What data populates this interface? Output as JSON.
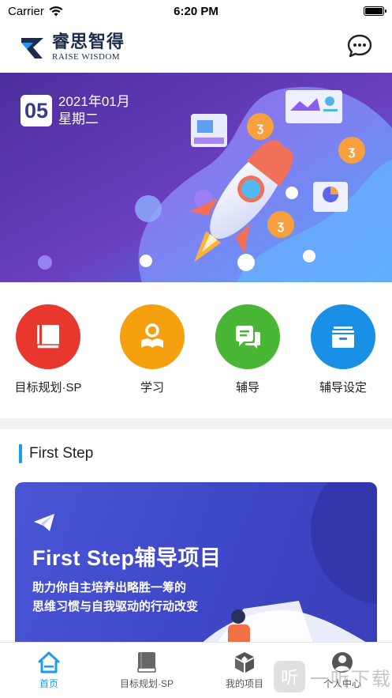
{
  "status_bar": {
    "carrier": "Carrier",
    "time": "6:20 PM",
    "battery_level": 1.0
  },
  "header": {
    "logo_cn": "睿思智得",
    "logo_en": "RAISE WISDOM",
    "chat_icon": "chat-bubble-icon"
  },
  "banner": {
    "day": "05",
    "month": "2021年01月",
    "weekday": "星期二"
  },
  "quick_actions": [
    {
      "label": "目标规划·SP",
      "icon": "book-icon",
      "color": "#e8372c"
    },
    {
      "label": "学习",
      "icon": "reader-icon",
      "color": "#f5a00e"
    },
    {
      "label": "辅导",
      "icon": "chat-icon",
      "color": "#49b636"
    },
    {
      "label": "辅导设定",
      "icon": "archive-icon",
      "color": "#1a8fe6"
    }
  ],
  "section": {
    "title": "First Step"
  },
  "promo": {
    "title": "First Step辅导项目",
    "subtitle_line1": "助力你自主培养出略胜一筹的",
    "subtitle_line2": "思维习惯与自我驱动的行动改变",
    "icon": "paper-plane-icon"
  },
  "tabbar": [
    {
      "label": "首页",
      "icon": "home-icon",
      "active": true
    },
    {
      "label": "目标规划·SP",
      "icon": "book-icon",
      "active": false
    },
    {
      "label": "我的项目",
      "icon": "cube-icon",
      "active": false
    },
    {
      "label": "个人中心",
      "icon": "user-icon",
      "active": false
    }
  ],
  "watermark": {
    "badge": "听",
    "text": "一听下载"
  },
  "colors": {
    "accent": "#1c9bf0",
    "banner_start": "#5b3fb4",
    "banner_end": "#3a8ef0"
  }
}
